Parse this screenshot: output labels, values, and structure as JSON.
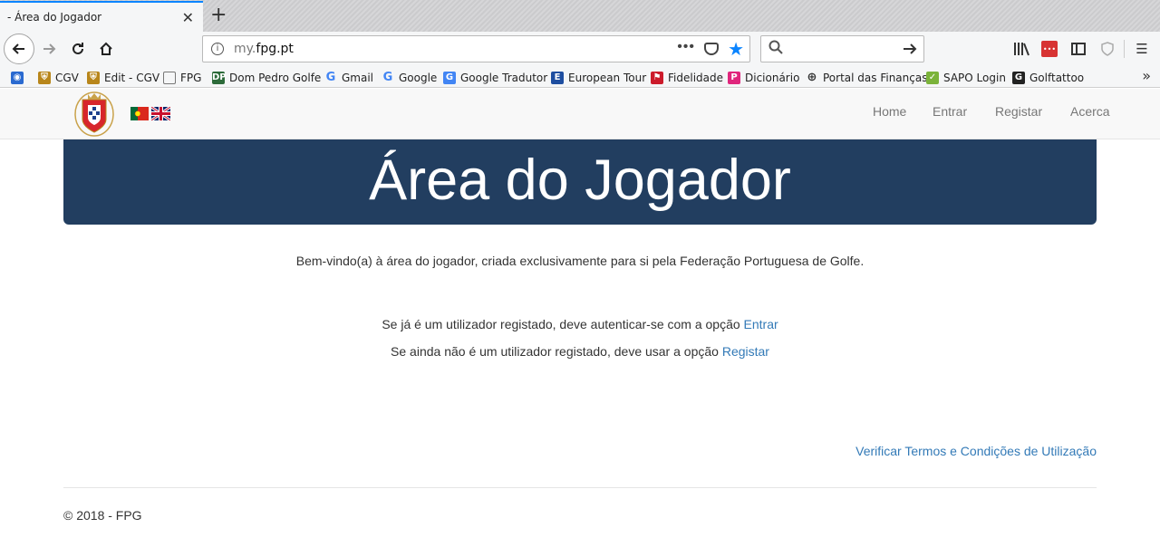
{
  "browser": {
    "tab_title": "- Área do Jogador",
    "tab_close": "✕",
    "new_tab": "+",
    "url_prefix": "my.",
    "url_domain": "fpg.pt",
    "url_dots": "•••",
    "bookmarks": [
      {
        "label": "",
        "icon": "firefox-logo",
        "color": "#2a6ad0"
      },
      {
        "label": "CGV",
        "icon": "cgv-shield",
        "color": "#b8861b"
      },
      {
        "label": "Edit - CGV",
        "icon": "cgv-shield",
        "color": "#b8861b"
      },
      {
        "label": "FPG",
        "icon": "folder",
        "color": "#777777"
      },
      {
        "label": "Dom Pedro Golfe",
        "icon": "dom-pedro-logo",
        "color": "#2d6b3a"
      },
      {
        "label": "Gmail",
        "icon": "google-g",
        "color": "#4285f4"
      },
      {
        "label": "Google",
        "icon": "google-g",
        "color": "#4285f4"
      },
      {
        "label": "Google Tradutor",
        "icon": "translate",
        "color": "#4285f4"
      },
      {
        "label": "European Tour",
        "icon": "european-tour-logo",
        "color": "#1e4ea0"
      },
      {
        "label": "Fidelidade",
        "icon": "fidelidade-flag",
        "color": "#cc1b2b"
      },
      {
        "label": "Dicionário",
        "icon": "priberam-logo",
        "color": "#e0267d"
      },
      {
        "label": "Portal das Finanças",
        "icon": "globe",
        "color": "#333333"
      },
      {
        "label": "SAPO Login",
        "icon": "sapo-logo",
        "color": "#7bb33a"
      },
      {
        "label": "Golftattoo",
        "icon": "golftattoo-g",
        "color": "#222222"
      }
    ]
  },
  "site": {
    "nav": [
      "Home",
      "Entrar",
      "Registar",
      "Acerca"
    ],
    "hero_title": "Área do Jogador",
    "welcome": "Bem-vindo(a) à área do jogador, criada exclusivamente para si pela Federação Portuguesa de Golfe.",
    "line1_text": "Se já é um utilizador registado, deve autenticar-se com a opção ",
    "line1_link": "Entrar",
    "line2_text": "Se ainda não é um utilizador registado, deve usar a opção ",
    "line2_link": "Registar",
    "terms_link": "Verificar Termos e Condições de Utilização",
    "copyright": "© 2018 - FPG",
    "colors": {
      "hero_bg": "#223e60",
      "link": "#337ab7",
      "tab_accent": "#0a84ff"
    }
  }
}
